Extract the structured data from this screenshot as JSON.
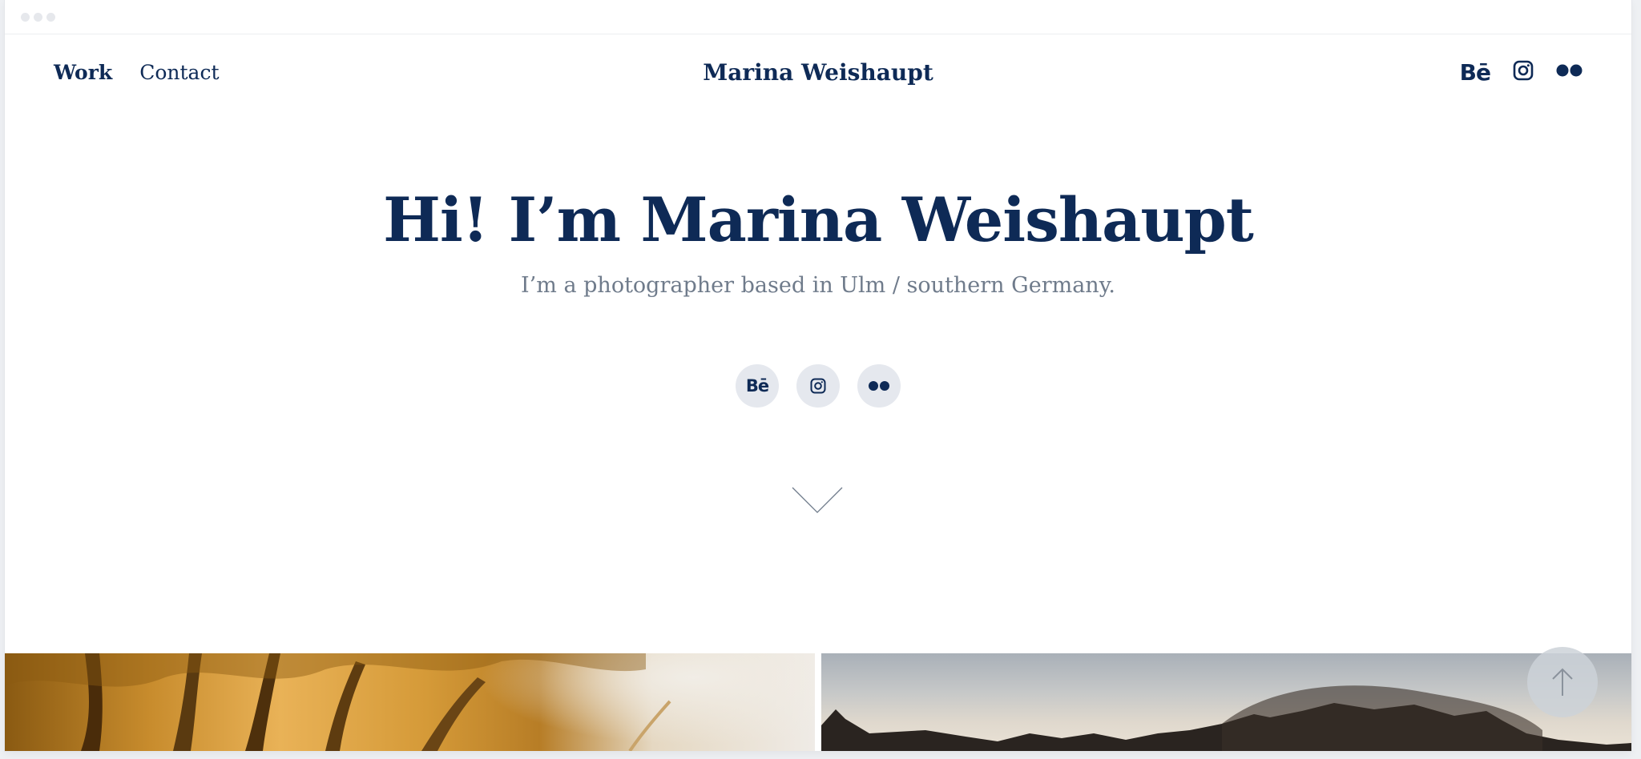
{
  "nav": {
    "work_label": "Work",
    "contact_label": "Contact",
    "brand": "Marina Weishaupt",
    "behance_label": "Bē"
  },
  "hero": {
    "title": "Hi! I’m Marina Weishaupt",
    "subtitle": "I’m a photographer based in Ulm / southern Germany."
  },
  "socials": {
    "behance_label": "Bē"
  },
  "icons": {
    "nav": [
      "behance-icon",
      "instagram-icon",
      "flickr-icon"
    ],
    "hero": [
      "behance-icon",
      "instagram-icon",
      "flickr-icon"
    ],
    "scroll_down": "chevron-down-icon",
    "scroll_top": "arrow-up-icon"
  },
  "colors": {
    "primary": "#0e2a56",
    "muted_text": "#6f7b8b",
    "social_bg": "#e5e8ee",
    "background": "#ffffff"
  }
}
